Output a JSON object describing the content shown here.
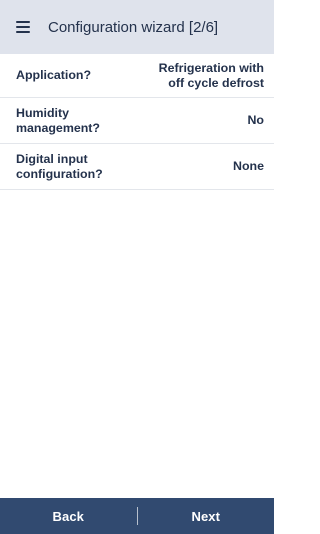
{
  "header": {
    "title": "Configuration wizard [2/6]"
  },
  "rows": [
    {
      "label": "Application?",
      "value": "Refrigeration with\noff cycle defrost"
    },
    {
      "label": "Humidity\nmanagement?",
      "value": "No"
    },
    {
      "label": "Digital input\nconfiguration?",
      "value": "None"
    }
  ],
  "footer": {
    "back_label": "Back",
    "next_label": "Next"
  },
  "colors": {
    "header_background": "#dfe3ec",
    "header_text": "#24324c",
    "footer_background": "#314a70",
    "footer_text": "#ffffff"
  },
  "icons": {
    "menu": "hamburger-menu"
  }
}
